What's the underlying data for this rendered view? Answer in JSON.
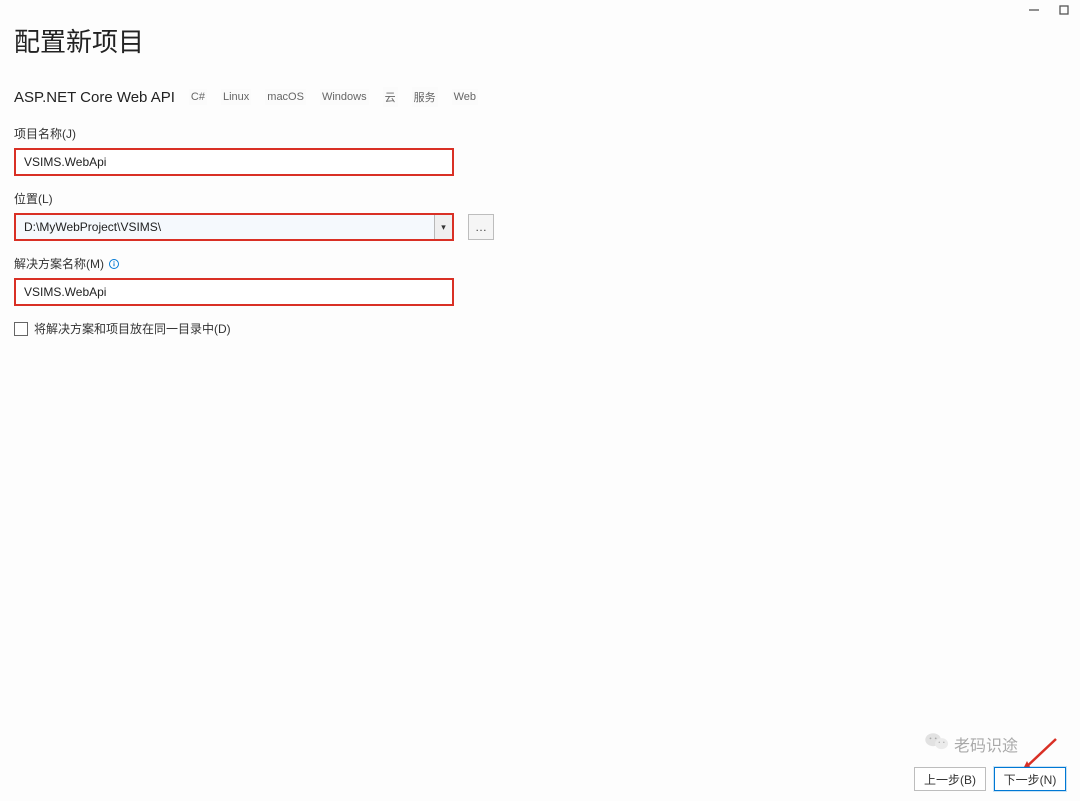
{
  "header": {
    "title": "配置新项目",
    "subtitle": "ASP.NET Core Web API",
    "tags": [
      "C#",
      "Linux",
      "macOS",
      "Windows",
      "云",
      "服务",
      "Web"
    ]
  },
  "fields": {
    "projectName": {
      "label": "项目名称(J)",
      "value": "VSIMS.WebApi"
    },
    "location": {
      "label": "位置(L)",
      "value": "D:\\MyWebProject\\VSIMS\\",
      "browse": "…"
    },
    "solutionName": {
      "label": "解决方案名称(M)",
      "value": "VSIMS.WebApi"
    },
    "sameDirCheckbox": {
      "label": "将解决方案和项目放在同一目录中(D)",
      "checked": false
    }
  },
  "footer": {
    "back": "上一步(B)",
    "next": "下一步(N)"
  },
  "watermark": "老码识途"
}
